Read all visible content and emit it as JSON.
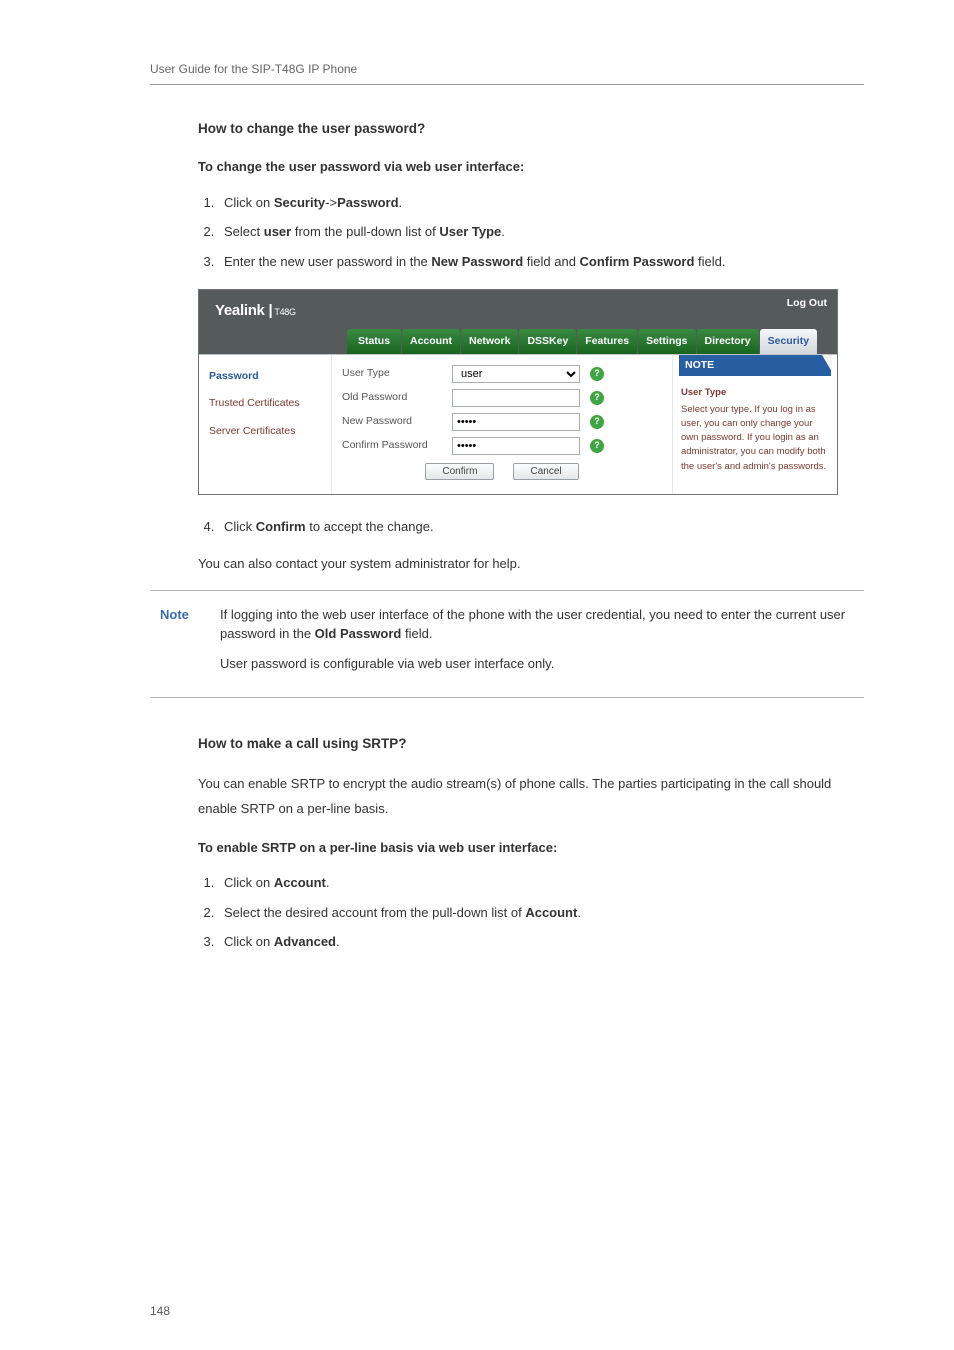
{
  "header": {
    "title": "User Guide for the SIP-T48G IP Phone"
  },
  "section1": {
    "heading": "How to change the user password?",
    "intro": "To change the user password via web user interface:",
    "steps": [
      {
        "pre": "Click on ",
        "b1": "Security",
        "mid": "->",
        "b2": "Password",
        "post": "."
      },
      {
        "pre": "Select ",
        "b1": "user",
        "mid": " from the pull-down list of ",
        "b2": "User Type",
        "post": "."
      },
      {
        "pre": "Enter the new user password in the ",
        "b1": "New Password",
        "mid": " field and ",
        "b2": "Confirm Password",
        "post": " field."
      }
    ],
    "after_img_step": {
      "pre": "Click ",
      "b1": "Confirm",
      "post": " to accept the change."
    },
    "after_img_body": "You can also contact your system administrator for help."
  },
  "webshot": {
    "logo": "Yealink",
    "model": "T48G",
    "logout": "Log Out",
    "tabs": [
      "Status",
      "Account",
      "Network",
      "DSSKey",
      "Features",
      "Settings",
      "Directory",
      "Security"
    ],
    "active_tab": 7,
    "side": {
      "items": [
        "Password",
        "Trusted Certificates",
        "Server Certificates"
      ],
      "current": 0
    },
    "form": {
      "rows": [
        {
          "label": "User Type",
          "type": "select",
          "value": "user"
        },
        {
          "label": "Old Password",
          "type": "text",
          "value": ""
        },
        {
          "label": "New Password",
          "type": "password",
          "value": "•••••"
        },
        {
          "label": "Confirm Password",
          "type": "password",
          "value": "•••••"
        }
      ],
      "confirm": "Confirm",
      "cancel": "Cancel"
    },
    "note": {
      "title": "NOTE",
      "section_title": "User Type",
      "body": "Select your type. If you log in as user, you can only change your own password. If you login as an administrator, you can modify both the user's and admin's passwords."
    }
  },
  "note_block": {
    "label": "Note",
    "p1a": "If logging into the web user interface of the phone with the user credential, you need to enter the current user password in the ",
    "p1b": "Old Password",
    "p1c": " field.",
    "p2": "User password is configurable via web user interface only."
  },
  "section2": {
    "heading": "How to make a call using SRTP?",
    "body": "You can enable SRTP to encrypt the audio stream(s) of phone calls. The parties participating in the call should enable SRTP on a per-line basis.",
    "intro": "To enable SRTP on a per-line basis via web user interface:",
    "steps": [
      {
        "pre": "Click on ",
        "b1": "Account",
        "post": "."
      },
      {
        "pre": "Select the desired account from the pull-down list of ",
        "b1": "Account",
        "post": "."
      },
      {
        "pre": "Click on ",
        "b1": "Advanced",
        "post": "."
      }
    ]
  },
  "page_number": "148"
}
